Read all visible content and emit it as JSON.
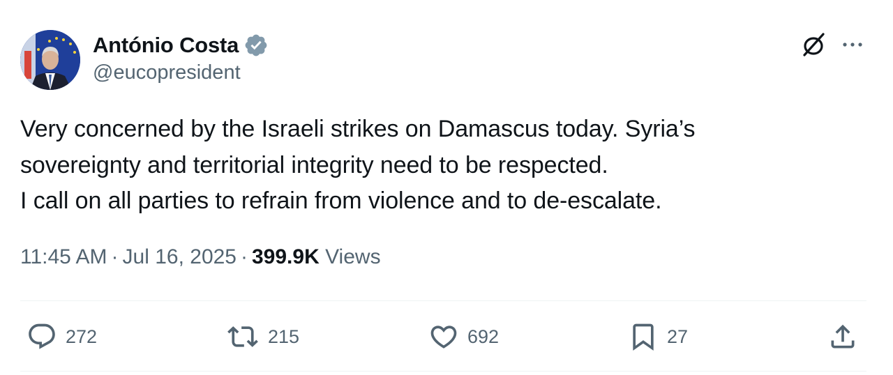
{
  "author": {
    "display_name": "António Costa",
    "handle": "@eucopresident",
    "verified": true,
    "verified_color": "#829aab"
  },
  "tweet": {
    "lines": [
      "Very concerned by the Israeli strikes on Damascus today. Syria’s",
      "sovereignty and territorial integrity need to be respected.",
      "I call on all parties to refrain from violence and to de-escalate."
    ],
    "time": "11:45 AM",
    "separator": "·",
    "date": "Jul 16, 2025",
    "views_count": "399.9K",
    "views_label": "Views"
  },
  "header_icons": {
    "grok": "grok-icon",
    "more": "more-icon"
  },
  "actions": {
    "reply": {
      "icon": "reply-icon",
      "count": "272"
    },
    "retweet": {
      "icon": "retweet-icon",
      "count": "215"
    },
    "like": {
      "icon": "heart-icon",
      "count": "692"
    },
    "bookmark": {
      "icon": "bookmark-icon",
      "count": "27"
    },
    "share": {
      "icon": "share-icon"
    }
  },
  "colors": {
    "text_primary": "#0f1419",
    "text_secondary": "#536471",
    "divider": "#eff3f4"
  }
}
